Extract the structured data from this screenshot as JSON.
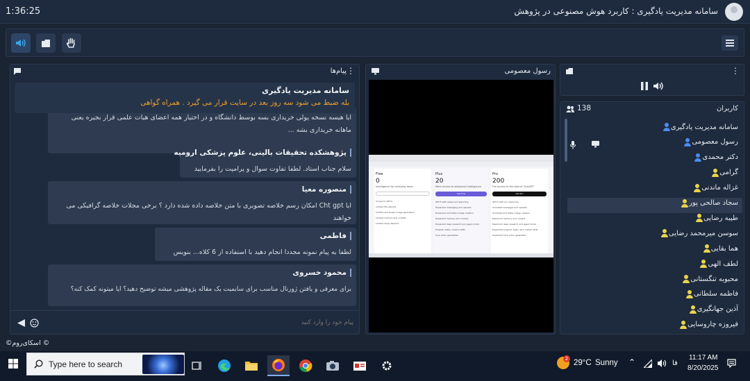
{
  "topbar": {
    "timer": "1:36:25",
    "title": "سامانه مدیریت یادگیری : کاربرد هوش مصنوعی در پژوهش"
  },
  "chat": {
    "header": "پیام‌ها",
    "pinned": {
      "name": "سامانه مدیریت یادگیری",
      "text": "بله ضبط می شود سه روز بعد در سایت قرار می گیرد . همراه گواهی"
    },
    "cut_message": {
      "line1": "ایا هیسه نسخه پولی خریداری بسه بوسط دانشگاه و در اختیار همه اعضای هیات علمی قرار بجیره یعنی",
      "line2": "ماهانه خریداری بشه ..."
    },
    "messages": [
      {
        "name": "پژوهشکده تحقیقات بالینی، علوم پزشکی ارومیه",
        "text": "سلام جناب استاد. لطفا تفاوت سوال و پرامپت را بفرمایید"
      },
      {
        "name": "منصوره معیا",
        "text": "ایا Cht gpt امکان رسم خلاصه تصویری با متن خلاصه داده شده دارد ؟ برخی مجلات خلاصه گرافیکی می خواهند"
      },
      {
        "name": "فاطمی",
        "text": "لطفا یه پیام نمونه مجددا انجام دهید با استفاده از 6 کلاه... بنویس"
      },
      {
        "name": "محمود خسروی",
        "text": "برای معرفی و یافتن ژورنال مناسب برای سابمیت یک مقاله پژوهشی میشه توضیح دهید؟ ایا میتونه کمک کنه؟"
      }
    ],
    "input_placeholder": "پیام خود را وارد کنید"
  },
  "video": {
    "header": "رسول معصومی",
    "plans": [
      {
        "name": "Free",
        "price": "0",
        "desc": "Intelligence for everyday tasks",
        "features": [
          "Access to GPT-4",
          "Limited file uploads",
          "Limited and slower image generation",
          "Limited memory and context",
          "Limited deep research"
        ]
      },
      {
        "name": "Plus",
        "price": "20",
        "desc": "More access to advanced intelligence",
        "button": "Get Plus",
        "features": [
          "GPT-5 with advanced reasoning",
          "Expanded messaging and uploads",
          "Expanded and faster image creation",
          "Expanded memory and context",
          "Expanded deep research and agent mode",
          "Projects, tasks, custom GPTs",
          "Sora video generation"
        ]
      },
      {
        "name": "Pro",
        "price": "200",
        "desc": "Full access to the best of ChatGPT",
        "button": "Get Pro",
        "features": [
          "GPT-5 with pro reasoning",
          "Unlimited messages and uploads",
          "Unlimited and faster image creation",
          "Maximum memory and context",
          "Maximum deep research and agent mode",
          "Expanded projects, tasks, and custom GPTs",
          "Expanded Sora video generation"
        ]
      }
    ]
  },
  "users": {
    "header": "کاربران",
    "count": "138",
    "list": [
      {
        "name": "سامانه مدیریت یادگیری",
        "color": "#4a8df0"
      },
      {
        "name": "رسول معصومی",
        "color": "#4a8df0"
      },
      {
        "name": "دکتر محمدی",
        "color": "#4a8df0"
      },
      {
        "name": "گرامی",
        "color": "#e8d44d"
      },
      {
        "name": "غزاله ماندنی",
        "color": "#e8d44d"
      },
      {
        "name": "سجاد صالحی پور",
        "color": "#e8d44d"
      },
      {
        "name": "طیبه رضایی",
        "color": "#e8d44d"
      },
      {
        "name": "سوسن میرمحمد رضایی",
        "color": "#e8d44d"
      },
      {
        "name": "هما بقایی",
        "color": "#e8d44d"
      },
      {
        "name": "لطف الهی",
        "color": "#e8d44d"
      },
      {
        "name": "محبوبه تنگستانی",
        "color": "#e8d44d"
      },
      {
        "name": "فاطمه سلطانی",
        "color": "#e8d44d"
      },
      {
        "name": "آذین جهانگیری",
        "color": "#e8d44d"
      },
      {
        "name": "فیروزه چاروسایی",
        "color": "#e8d44d"
      }
    ]
  },
  "footer": {
    "brand": "©اسکای‌روم ©"
  },
  "taskbar": {
    "search_placeholder": "Type here to search",
    "weather_temp": "29°C",
    "weather_text": "Sunny",
    "weather_badge": "2",
    "lang": "فا",
    "time": "11:17 AM",
    "date": "8/20/2025"
  },
  "colors": {
    "background": "#1b2433",
    "panel": "#1e2a3d",
    "message": "#2e3b50",
    "pinned_text": "#f0a030",
    "presenter_icon": "#4a8df0",
    "attendee_icon": "#e8d44d"
  }
}
